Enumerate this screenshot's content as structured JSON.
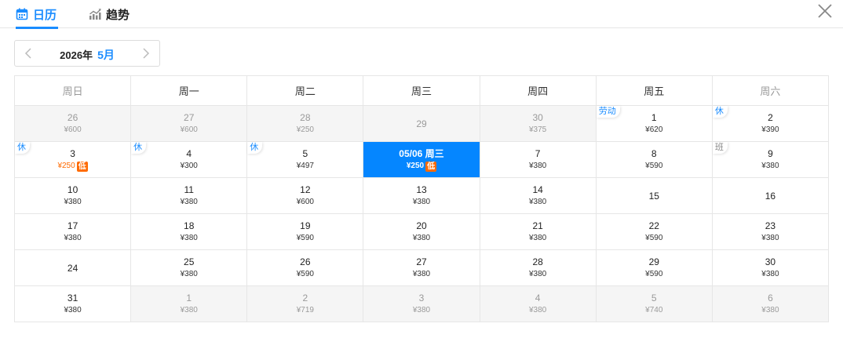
{
  "tabs": [
    {
      "label": "日历",
      "icon": "calendar-icon",
      "active": true
    },
    {
      "label": "趋势",
      "icon": "trend-chart-icon",
      "active": false
    }
  ],
  "colors": {
    "accent": "#1a8cff",
    "selected_bg": "#0586ff",
    "low": "#ff6a00"
  },
  "month_nav": {
    "year": "2026年",
    "month": "5月"
  },
  "weekdays": [
    "周日",
    "周一",
    "周二",
    "周三",
    "周四",
    "周五",
    "周六"
  ],
  "weeks": [
    [
      {
        "day": "26",
        "price": "¥600",
        "other": true
      },
      {
        "day": "27",
        "price": "¥600",
        "other": true
      },
      {
        "day": "28",
        "price": "¥250",
        "other": true
      },
      {
        "day": "29",
        "price": "",
        "other": true
      },
      {
        "day": "30",
        "price": "¥375",
        "other": true
      },
      {
        "day": "1",
        "price": "¥620",
        "tag": "劳动",
        "tag_type": "rest"
      },
      {
        "day": "2",
        "price": "¥390",
        "tag": "休",
        "tag_type": "rest"
      }
    ],
    [
      {
        "day": "3",
        "price": "¥250",
        "low": true,
        "low_label": "低",
        "tag": "休",
        "tag_type": "rest"
      },
      {
        "day": "4",
        "price": "¥300",
        "tag": "休",
        "tag_type": "rest"
      },
      {
        "day": "5",
        "price": "¥497",
        "tag": "休",
        "tag_type": "rest"
      },
      {
        "day": "05/06 周三",
        "price": "¥250",
        "low": true,
        "low_label": "低",
        "selected": true
      },
      {
        "day": "7",
        "price": "¥380"
      },
      {
        "day": "8",
        "price": "¥590"
      },
      {
        "day": "9",
        "price": "¥380",
        "tag": "班",
        "tag_type": "work"
      }
    ],
    [
      {
        "day": "10",
        "price": "¥380"
      },
      {
        "day": "11",
        "price": "¥380"
      },
      {
        "day": "12",
        "price": "¥600"
      },
      {
        "day": "13",
        "price": "¥380"
      },
      {
        "day": "14",
        "price": "¥380"
      },
      {
        "day": "15",
        "price": ""
      },
      {
        "day": "16",
        "price": ""
      }
    ],
    [
      {
        "day": "17",
        "price": "¥380"
      },
      {
        "day": "18",
        "price": "¥380"
      },
      {
        "day": "19",
        "price": "¥590"
      },
      {
        "day": "20",
        "price": "¥380"
      },
      {
        "day": "21",
        "price": "¥380"
      },
      {
        "day": "22",
        "price": "¥590"
      },
      {
        "day": "23",
        "price": "¥380"
      }
    ],
    [
      {
        "day": "24",
        "price": ""
      },
      {
        "day": "25",
        "price": "¥380"
      },
      {
        "day": "26",
        "price": "¥590"
      },
      {
        "day": "27",
        "price": "¥380"
      },
      {
        "day": "28",
        "price": "¥380"
      },
      {
        "day": "29",
        "price": "¥590"
      },
      {
        "day": "30",
        "price": "¥380"
      }
    ],
    [
      {
        "day": "31",
        "price": "¥380"
      },
      {
        "day": "1",
        "price": "¥380",
        "other": true
      },
      {
        "day": "2",
        "price": "¥719",
        "other": true
      },
      {
        "day": "3",
        "price": "¥380",
        "other": true
      },
      {
        "day": "4",
        "price": "¥380",
        "other": true
      },
      {
        "day": "5",
        "price": "¥740",
        "other": true
      },
      {
        "day": "6",
        "price": "¥380",
        "other": true
      }
    ]
  ]
}
